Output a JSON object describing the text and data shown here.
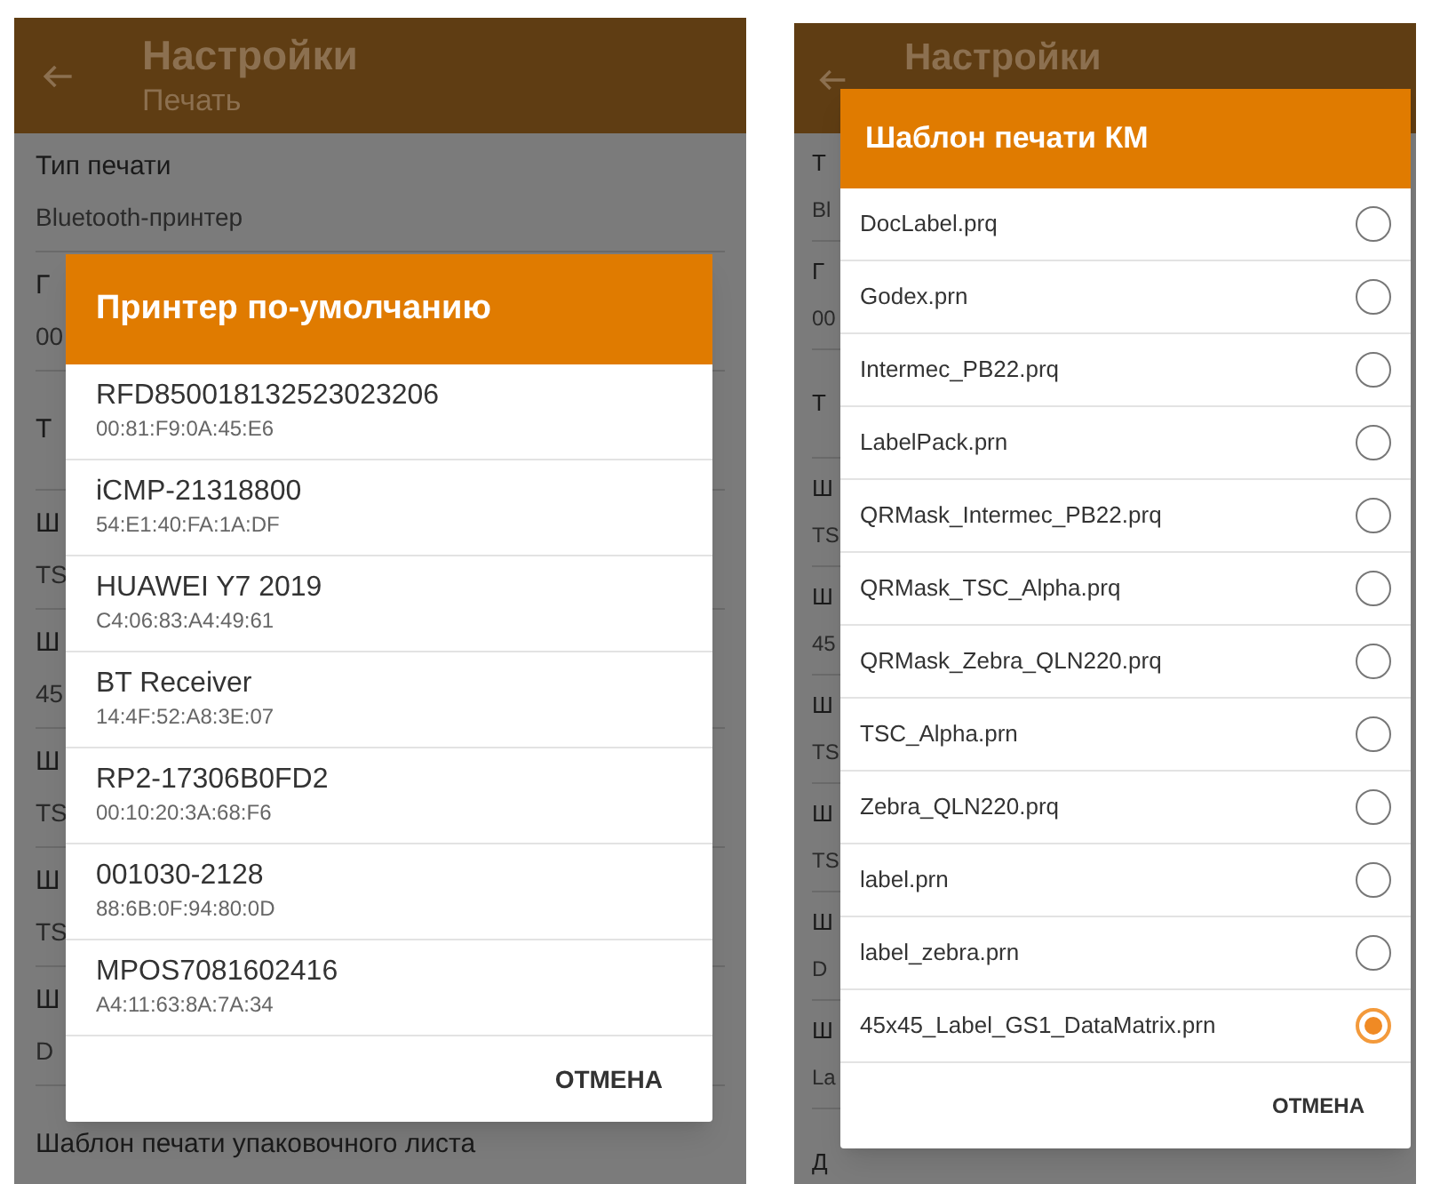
{
  "screens": [
    {
      "header": {
        "title": "Настройки",
        "subtitle": "Печать"
      },
      "settings": [
        {
          "label": "Тип печати",
          "value": "Bluetooth-принтер"
        },
        {
          "label": "Г",
          "value": "00"
        },
        {
          "label": "Т"
        },
        {
          "label": "Ш",
          "value": "TS"
        },
        {
          "label": "Ш",
          "value": "45"
        },
        {
          "label": "Ш",
          "value": "TS"
        },
        {
          "label": "Ш",
          "value": "TS"
        },
        {
          "label": "Ш",
          "value": "D"
        },
        {
          "label": "Шаблон печати упаковочного листа"
        }
      ],
      "dialog": {
        "kind": "device_list",
        "title": "Принтер по-умолчанию",
        "items": [
          {
            "name": "RFD850018132523023206",
            "address": "00:81:F9:0A:45:E6"
          },
          {
            "name": "iCMP-21318800",
            "address": "54:E1:40:FA:1A:DF"
          },
          {
            "name": "HUAWEI Y7 2019",
            "address": "C4:06:83:A4:49:61"
          },
          {
            "name": "BT Receiver",
            "address": "14:4F:52:A8:3E:07"
          },
          {
            "name": "RP2-17306B0FD2",
            "address": "00:10:20:3A:68:F6"
          },
          {
            "name": "001030-2128",
            "address": "88:6B:0F:94:80:0D"
          },
          {
            "name": "MPOS7081602416",
            "address": "A4:11:63:8A:7A:34"
          }
        ],
        "cancel": "ОТМЕНА"
      }
    },
    {
      "header": {
        "title": "Настройки"
      },
      "settings": [
        {
          "label": "Т",
          "value": "Bl"
        },
        {
          "label": "Г",
          "value": "00"
        },
        {
          "label": "Т"
        },
        {
          "label": "Ш",
          "value": "TS"
        },
        {
          "label": "Ш",
          "value": "45"
        },
        {
          "label": "Ш",
          "value": "TS"
        },
        {
          "label": "Ш",
          "value": "TS"
        },
        {
          "label": "Ш",
          "value": "D"
        },
        {
          "label": "Ш",
          "value": "La"
        },
        {
          "label": "Д"
        }
      ],
      "dialog": {
        "kind": "radio_list",
        "title": "Шаблон печати КМ",
        "items": [
          {
            "name": "DocLabel.prq",
            "selected": false
          },
          {
            "name": "Godex.prn",
            "selected": false
          },
          {
            "name": "Intermec_PB22.prq",
            "selected": false
          },
          {
            "name": "LabelPack.prn",
            "selected": false
          },
          {
            "name": "QRMask_Intermec_PB22.prq",
            "selected": false
          },
          {
            "name": "QRMask_TSC_Alpha.prq",
            "selected": false
          },
          {
            "name": "QRMask_Zebra_QLN220.prq",
            "selected": false
          },
          {
            "name": "TSC_Alpha.prn",
            "selected": false
          },
          {
            "name": "Zebra_QLN220.prq",
            "selected": false
          },
          {
            "name": "label.prn",
            "selected": false
          },
          {
            "name": "label_zebra.prn",
            "selected": false
          },
          {
            "name": "45x45_Label_GS1_DataMatrix.prn",
            "selected": true
          }
        ],
        "cancel": "ОТМЕНА"
      }
    }
  ]
}
